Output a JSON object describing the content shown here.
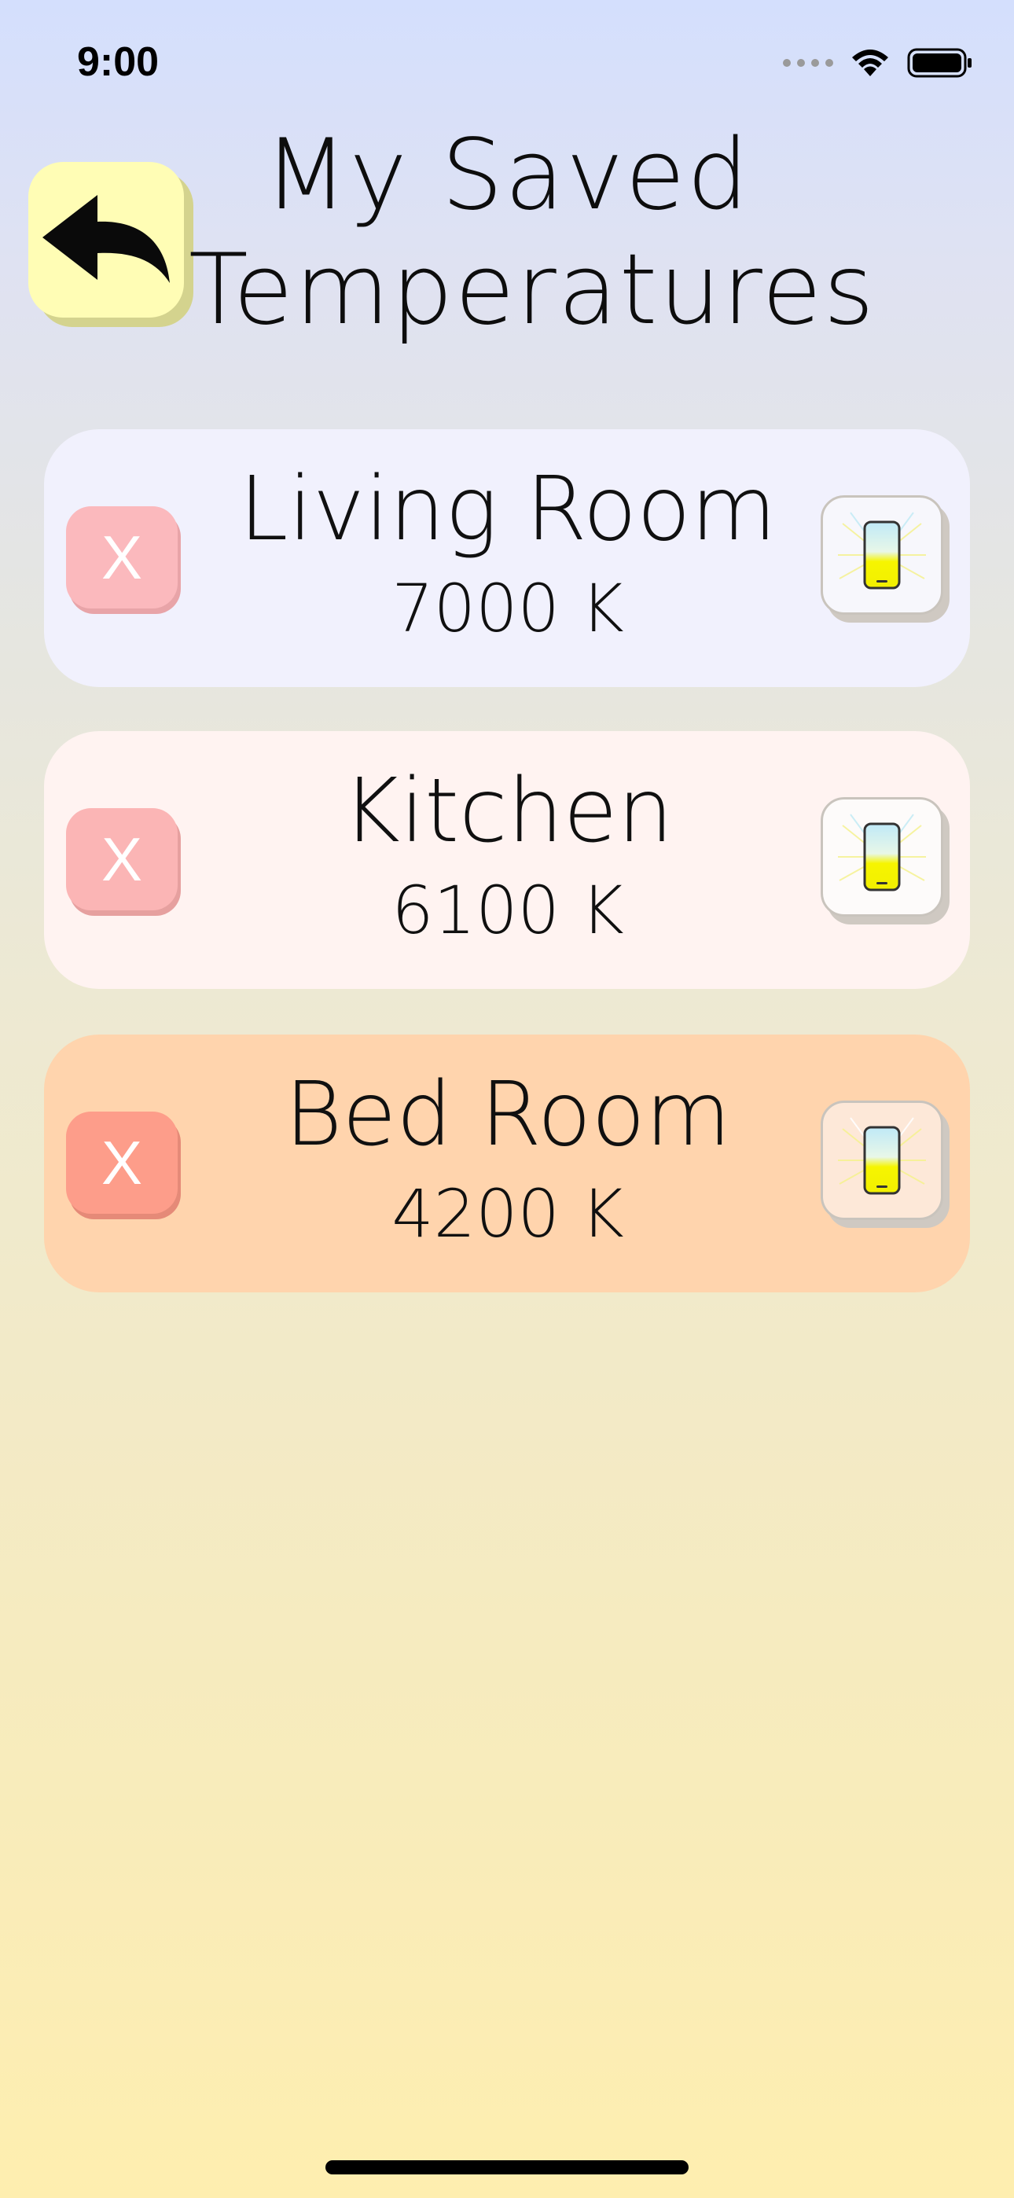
{
  "status_bar": {
    "time": "9:00"
  },
  "header": {
    "back_icon": "back-arrow-icon",
    "title_line1": "My Saved",
    "title_line2": "Temperatures",
    "back_button_color": "#fffdb5"
  },
  "saved_temperatures": [
    {
      "name": "Living Room",
      "temperature": "7000 K",
      "remove_label": "X",
      "card_color": "#f1f1fd",
      "remove_color": "#fbb9bd",
      "apply_bg": "#f7f7fc"
    },
    {
      "name": "Kitchen",
      "temperature": "6100 K",
      "remove_label": "X",
      "card_color": "#fff3f1",
      "remove_color": "#fbb5b5",
      "apply_bg": "#fdfbfa"
    },
    {
      "name": "Bed Room",
      "temperature": "4200 K",
      "remove_label": "X",
      "card_color": "#ffd4ad",
      "remove_color": "#fd9d8a",
      "apply_bg": "#fde8d8"
    }
  ],
  "icons": {
    "apply": "phone-glow-icon",
    "remove": "x"
  }
}
